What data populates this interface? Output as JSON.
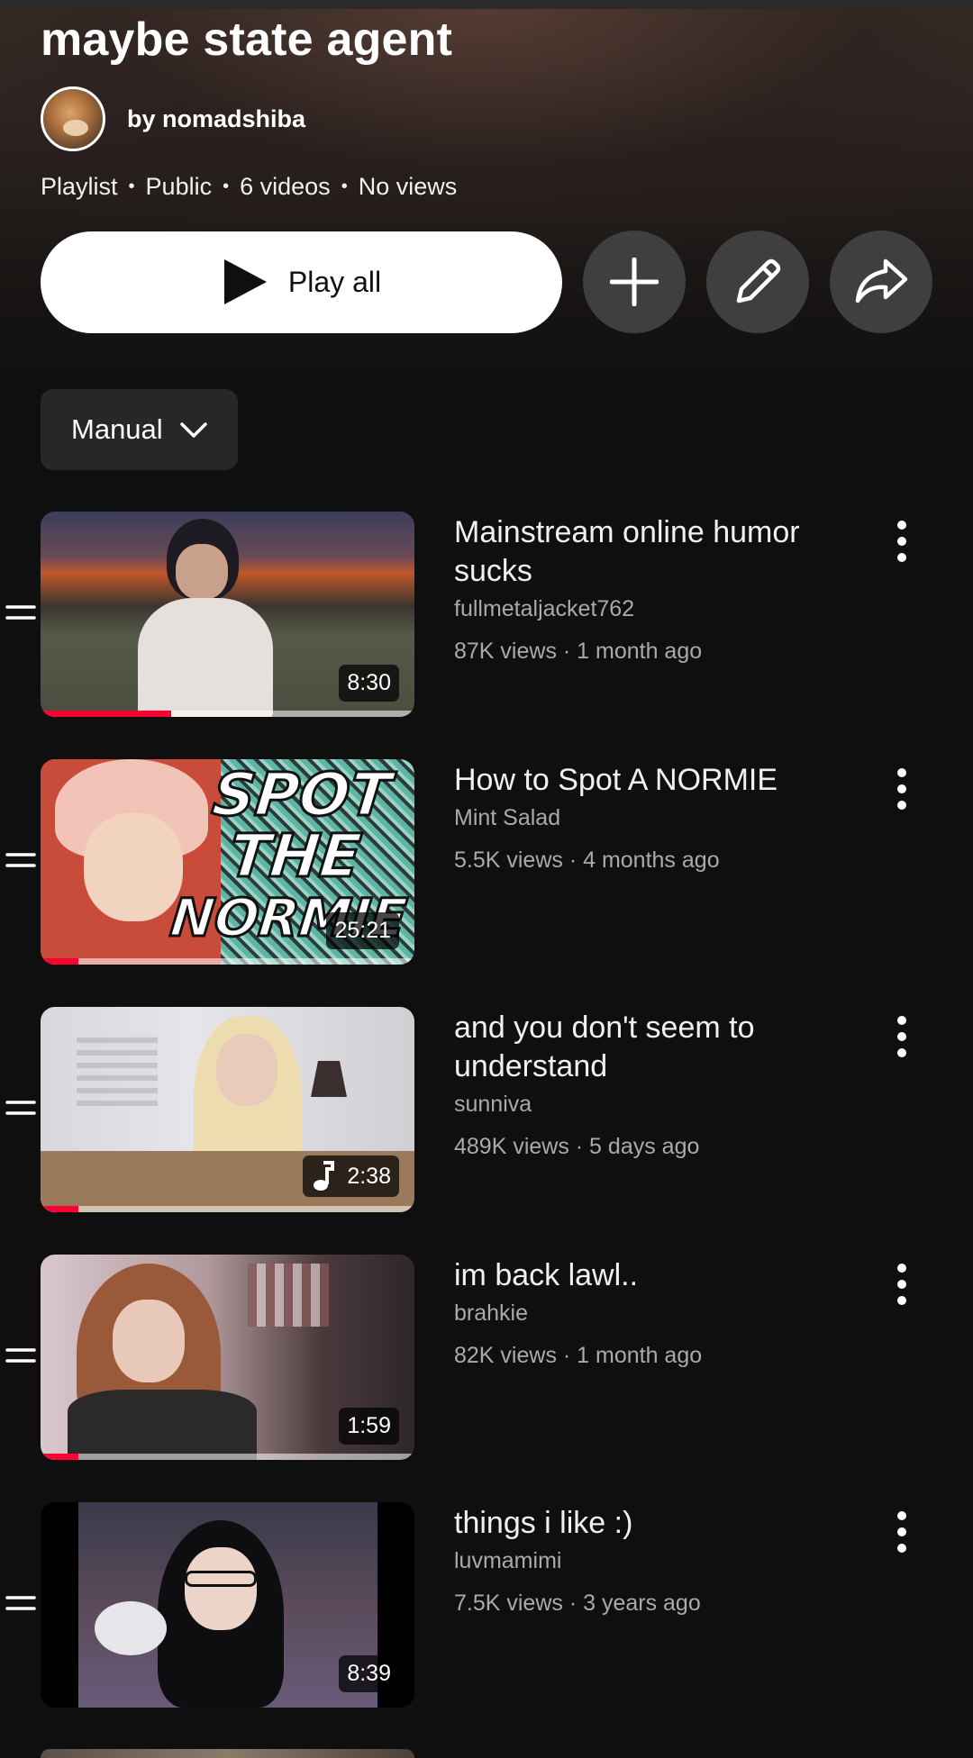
{
  "playlist": {
    "title": "maybe state agent",
    "owner": "by nomadshiba",
    "meta": [
      "Playlist",
      "Public",
      "6 videos",
      "No views"
    ],
    "meta_separator": "•"
  },
  "actions": {
    "play_all_label": "Play all",
    "icons": [
      "add-icon",
      "edit-pencil-icon",
      "share-icon"
    ]
  },
  "sort": {
    "selected": "Manual"
  },
  "colors": {
    "progress": "#ff0033",
    "background": "#0f0f0f",
    "secondary_text": "#aaaaaa"
  },
  "videos": [
    {
      "title_lines": [
        "Mainstream online humor",
        "sucks"
      ],
      "channel": "fullmetaljacket762",
      "stats": "87K views · 1 month ago",
      "duration": "8:30",
      "music": false,
      "watched_fraction": 0.35
    },
    {
      "title_lines": [
        "How to Spot A NORMIE"
      ],
      "channel": "Mint Salad",
      "stats": "5.5K views · 4 months ago",
      "duration": "25:21",
      "music": false,
      "watched_fraction": 0.1,
      "thumb_text": [
        "SPOT",
        "THE",
        "NORMIE"
      ]
    },
    {
      "title_lines": [
        "and you don't seem to",
        "understand"
      ],
      "channel": "sunniva",
      "stats": "489K views · 5 days ago",
      "duration": "2:38",
      "music": true,
      "watched_fraction": 0.1
    },
    {
      "title_lines": [
        "im back lawl.."
      ],
      "channel": "brahkie",
      "stats": "82K views · 1 month ago",
      "duration": "1:59",
      "music": false,
      "watched_fraction": 0.1
    },
    {
      "title_lines": [
        "things i like :)"
      ],
      "channel": "luvmamimi",
      "stats": "7.5K views · 3 years ago",
      "duration": "8:39",
      "music": false,
      "watched_fraction": 0
    }
  ]
}
